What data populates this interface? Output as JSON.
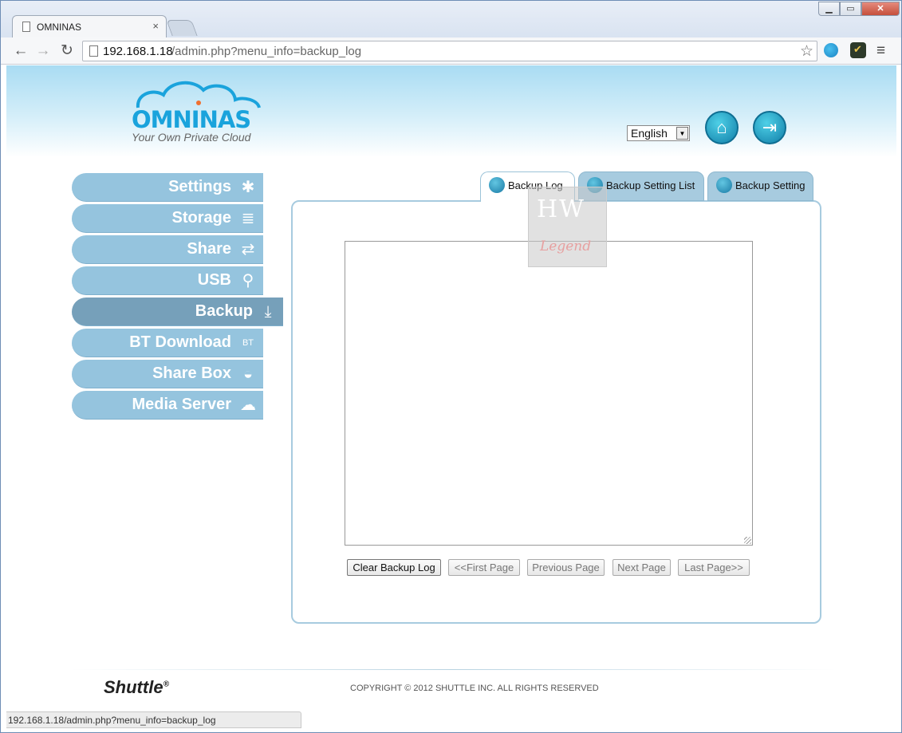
{
  "browser": {
    "tab_title": "OMNINAS",
    "tab_close": "×",
    "url_host": "192.168.1.18",
    "url_path": "/admin.php?menu_info=backup_log",
    "status_url": "192.168.1.18/admin.php?menu_info=backup_log",
    "window_controls": {
      "minimize": "▁",
      "maximize": "▭",
      "close": "✕"
    },
    "nav": {
      "back": "←",
      "forward": "→",
      "reload": "↻",
      "star": "☆",
      "menu": "≡"
    }
  },
  "header": {
    "logo_text": "OMNINAS",
    "logo_tagline": "Your Own Private Cloud",
    "language": "English",
    "language_arrow": "▼",
    "home_icon": "⌂",
    "logout_icon": "⇥"
  },
  "sidebar": {
    "items": [
      {
        "label": "Settings",
        "icon": "✱"
      },
      {
        "label": "Storage",
        "icon": "≣"
      },
      {
        "label": "Share",
        "icon": "⇄"
      },
      {
        "label": "USB",
        "icon": "⚲"
      },
      {
        "label": "Backup",
        "icon": "⤓"
      },
      {
        "label": "BT Download",
        "icon": "BT"
      },
      {
        "label": "Share Box",
        "icon": "◒"
      },
      {
        "label": "Media Server",
        "icon": "☁"
      }
    ],
    "active": "Backup"
  },
  "tabs": [
    {
      "label": "Backup Log"
    },
    {
      "label": "Backup Setting List"
    },
    {
      "label": "Backup Setting"
    }
  ],
  "watermark": {
    "top": "HW",
    "bottom": "Legend"
  },
  "log": {
    "content": ""
  },
  "buttons": {
    "clear": "Clear Backup Log",
    "first": "<<First Page",
    "previous": "Previous Page",
    "next": "Next Page",
    "last": "Last Page>>"
  },
  "footer": {
    "brand": "Shuttle",
    "brand_mark": "®",
    "copyright": "COPYRIGHT © 2012 SHUTTLE INC. ALL RIGHTS RESERVED"
  },
  "colors": {
    "accent": "#1aa3dc",
    "sidebar": "#95c4de",
    "sidebar_active": "#76a0ba",
    "tab": "#a7cbdf"
  }
}
